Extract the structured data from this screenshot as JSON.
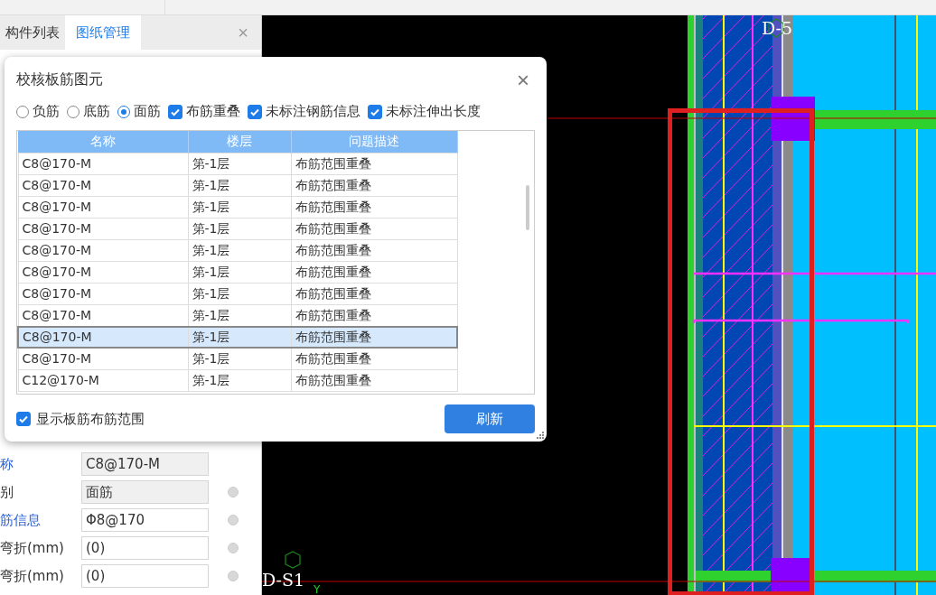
{
  "panel": {
    "tabs": [
      {
        "label": "构件列表",
        "selected": false
      },
      {
        "label": "图纸管理",
        "selected": true
      }
    ],
    "close": "×",
    "properties": [
      {
        "label": "称",
        "value": "C8@170-M",
        "link": true,
        "readonly": true,
        "dot": false
      },
      {
        "label": "别",
        "value": "面筋",
        "link": false,
        "readonly": true,
        "dot": true
      },
      {
        "label": "筋信息",
        "value": "Φ8@170",
        "link": true,
        "readonly": false,
        "dot": true
      },
      {
        "label": "弯折(mm)",
        "value": "(0)",
        "link": false,
        "readonly": false,
        "dot": true
      },
      {
        "label": "弯折(mm)",
        "value": "(0)",
        "link": false,
        "readonly": false,
        "dot": true
      }
    ]
  },
  "canvas": {
    "axis_labels": [
      "D-5",
      "D-S1"
    ],
    "axis_letter": "Y"
  },
  "dialog": {
    "title": "校核板筋图元",
    "close": "×",
    "options": [
      {
        "kind": "radio",
        "label": "负筋",
        "selected": false
      },
      {
        "kind": "radio",
        "label": "底筋",
        "selected": false
      },
      {
        "kind": "radio",
        "label": "面筋",
        "selected": true
      },
      {
        "kind": "checkbox",
        "label": "布筋重叠",
        "checked": true
      },
      {
        "kind": "checkbox",
        "label": "未标注钢筋信息",
        "checked": true
      },
      {
        "kind": "checkbox",
        "label": "未标注伸出长度",
        "checked": true
      }
    ],
    "table": {
      "columns": [
        "名称",
        "楼层",
        "问题描述"
      ],
      "rows": [
        {
          "cells": [
            "C8@170-M",
            "第-1层",
            "布筋范围重叠"
          ],
          "selected": false
        },
        {
          "cells": [
            "C8@170-M",
            "第-1层",
            "布筋范围重叠"
          ],
          "selected": false
        },
        {
          "cells": [
            "C8@170-M",
            "第-1层",
            "布筋范围重叠"
          ],
          "selected": false
        },
        {
          "cells": [
            "C8@170-M",
            "第-1层",
            "布筋范围重叠"
          ],
          "selected": false
        },
        {
          "cells": [
            "C8@170-M",
            "第-1层",
            "布筋范围重叠"
          ],
          "selected": false
        },
        {
          "cells": [
            "C8@170-M",
            "第-1层",
            "布筋范围重叠"
          ],
          "selected": false
        },
        {
          "cells": [
            "C8@170-M",
            "第-1层",
            "布筋范围重叠"
          ],
          "selected": false
        },
        {
          "cells": [
            "C8@170-M",
            "第-1层",
            "布筋范围重叠"
          ],
          "selected": false
        },
        {
          "cells": [
            "C8@170-M",
            "第-1层",
            "布筋范围重叠"
          ],
          "selected": true
        },
        {
          "cells": [
            "C8@170-M",
            "第-1层",
            "布筋范围重叠"
          ],
          "selected": false
        },
        {
          "cells": [
            "C12@170-M",
            "第-1层",
            "布筋范围重叠"
          ],
          "selected": false
        }
      ]
    },
    "show_range": {
      "label": "显示板筋布筋范围",
      "checked": true
    },
    "refresh_button": "刷新"
  }
}
